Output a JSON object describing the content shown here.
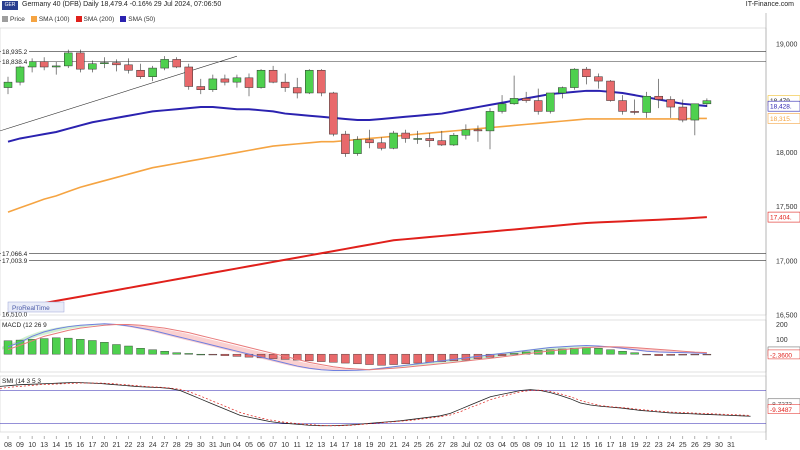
{
  "header": {
    "title": "Germany 40 (DFB) Daily 18,479.4 -0.16% 29 Jul 2024, 07:06:50",
    "brand": "IT-Finance.com",
    "logo_text": "GER"
  },
  "legend": [
    {
      "label": "Price",
      "color": "#9e9e9e"
    },
    {
      "label": "SMA (100)",
      "color": "#f5a442"
    },
    {
      "label": "SMA (200)",
      "color": "#e0201b"
    },
    {
      "label": "SMA (50)",
      "color": "#2b22b0"
    }
  ],
  "watermark": "ProRealTime",
  "colors": {
    "up": "#4ed04e",
    "down": "#e8696b",
    "sma50": "#2b22b0",
    "sma100": "#f5a442",
    "sma200": "#e0201b"
  },
  "chart_data": [
    {
      "type": "candlestick",
      "title": "Germany 40 (DFB) Daily",
      "ylim": [
        16500,
        19150
      ],
      "y_ticks": [
        16500,
        17000,
        17500,
        18000,
        18500,
        19000
      ],
      "x_labels": [
        "08",
        "09",
        "10",
        "13",
        "14",
        "15",
        "16",
        "17",
        "20",
        "21",
        "22",
        "23",
        "24",
        "27",
        "28",
        "29",
        "30",
        "31",
        "Jun",
        "04",
        "05",
        "06",
        "07",
        "10",
        "11",
        "12",
        "13",
        "14",
        "17",
        "18",
        "19",
        "20",
        "21",
        "24",
        "25",
        "26",
        "27",
        "28",
        "Jul",
        "02",
        "03",
        "04",
        "05",
        "08",
        "09",
        "10",
        "11",
        "12",
        "15",
        "16",
        "17",
        "18",
        "19",
        "22",
        "23",
        "24",
        "25",
        "26",
        "29",
        "30",
        "31"
      ],
      "price_tags": [
        {
          "value": 18935.2,
          "label": "18,935.2",
          "side": "left"
        },
        {
          "value": 18838.4,
          "label": "18,838.4",
          "side": "left"
        },
        {
          "value": 17066.4,
          "label": "17,066.4",
          "side": "left"
        },
        {
          "value": 17003.9,
          "label": "17,003.9",
          "side": "left"
        },
        {
          "value": 16510.0,
          "label": "16,510.0",
          "side": "left"
        },
        {
          "value": 18479.4,
          "label": "18,479.",
          "side": "right",
          "color": "#f0c030"
        },
        {
          "value": 18428,
          "label": "18,428.",
          "side": "right",
          "color": "#2b22b0"
        },
        {
          "value": 18315,
          "label": "18,315.",
          "side": "right",
          "color": "#f5a442"
        },
        {
          "value": 17404,
          "label": "17,404.",
          "side": "right",
          "color": "#e0201b"
        }
      ],
      "hlines": [
        18935.2,
        18838.4,
        17066.4,
        17003.9
      ],
      "candles": [
        [
          18600,
          18700,
          18540,
          18650
        ],
        [
          18650,
          18820,
          18620,
          18790
        ],
        [
          18790,
          18870,
          18740,
          18840
        ],
        [
          18840,
          18880,
          18760,
          18790
        ],
        [
          18790,
          18840,
          18720,
          18800
        ],
        [
          18800,
          18950,
          18780,
          18920
        ],
        [
          18920,
          18950,
          18740,
          18770
        ],
        [
          18770,
          18850,
          18740,
          18820
        ],
        [
          18820,
          18880,
          18780,
          18830
        ],
        [
          18830,
          18860,
          18750,
          18810
        ],
        [
          18810,
          18870,
          18730,
          18760
        ],
        [
          18760,
          18820,
          18680,
          18700
        ],
        [
          18700,
          18800,
          18660,
          18780
        ],
        [
          18780,
          18890,
          18760,
          18860
        ],
        [
          18860,
          18880,
          18780,
          18790
        ],
        [
          18790,
          18820,
          18580,
          18610
        ],
        [
          18610,
          18680,
          18540,
          18580
        ],
        [
          18580,
          18720,
          18560,
          18680
        ],
        [
          18680,
          18720,
          18620,
          18650
        ],
        [
          18650,
          18720,
          18600,
          18690
        ],
        [
          18690,
          18730,
          18520,
          18600
        ],
        [
          18600,
          18770,
          18590,
          18760
        ],
        [
          18760,
          18800,
          18640,
          18650
        ],
        [
          18650,
          18730,
          18560,
          18600
        ],
        [
          18600,
          18690,
          18500,
          18550
        ],
        [
          18550,
          18770,
          18540,
          18760
        ],
        [
          18760,
          18770,
          18520,
          18550
        ],
        [
          18550,
          18560,
          18150,
          18170
        ],
        [
          18170,
          18200,
          17960,
          17990
        ],
        [
          17990,
          18150,
          17970,
          18120
        ],
        [
          18120,
          18210,
          18040,
          18090
        ],
        [
          18090,
          18140,
          18020,
          18040
        ],
        [
          18040,
          18200,
          18030,
          18180
        ],
        [
          18180,
          18210,
          18090,
          18130
        ],
        [
          18130,
          18200,
          18080,
          18130
        ],
        [
          18130,
          18180,
          18050,
          18110
        ],
        [
          18110,
          18200,
          18060,
          18070
        ],
        [
          18070,
          18180,
          18060,
          18160
        ],
        [
          18160,
          18260,
          18120,
          18210
        ],
        [
          18210,
          18250,
          18100,
          18200
        ],
        [
          18200,
          18410,
          18030,
          18380
        ],
        [
          18380,
          18530,
          18360,
          18450
        ],
        [
          18450,
          18710,
          18440,
          18500
        ],
        [
          18500,
          18560,
          18460,
          18480
        ],
        [
          18480,
          18590,
          18350,
          18380
        ],
        [
          18380,
          18520,
          18360,
          18550
        ],
        [
          18550,
          18610,
          18500,
          18600
        ],
        [
          18600,
          18780,
          18580,
          18770
        ],
        [
          18770,
          18790,
          18630,
          18700
        ],
        [
          18700,
          18730,
          18590,
          18660
        ],
        [
          18660,
          18670,
          18470,
          18480
        ],
        [
          18480,
          18530,
          18350,
          18380
        ],
        [
          18380,
          18490,
          18350,
          18370
        ],
        [
          18370,
          18560,
          18320,
          18520
        ],
        [
          18520,
          18680,
          18410,
          18490
        ],
        [
          18490,
          18520,
          18320,
          18420
        ],
        [
          18420,
          18490,
          18280,
          18300
        ],
        [
          18300,
          18450,
          18160,
          18450
        ],
        [
          18450,
          18500,
          18420,
          18479
        ]
      ],
      "sma50": [
        18100,
        18130,
        18150,
        18170,
        18190,
        18220,
        18250,
        18280,
        18300,
        18320,
        18340,
        18360,
        18380,
        18390,
        18400,
        18410,
        18420,
        18420,
        18410,
        18400,
        18400,
        18390,
        18380,
        18360,
        18350,
        18340,
        18330,
        18320,
        18310,
        18300,
        18300,
        18310,
        18320,
        18330,
        18340,
        18350,
        18360,
        18380,
        18400,
        18420,
        18440,
        18460,
        18480,
        18500,
        18520,
        18540,
        18550,
        18560,
        18570,
        18570,
        18560,
        18550,
        18530,
        18510,
        18490,
        18470,
        18450,
        18440,
        18430
      ],
      "sma100": [
        17450,
        17490,
        17530,
        17570,
        17600,
        17640,
        17680,
        17710,
        17740,
        17770,
        17800,
        17830,
        17860,
        17880,
        17900,
        17920,
        17940,
        17960,
        17980,
        18000,
        18020,
        18040,
        18060,
        18070,
        18080,
        18090,
        18100,
        18100,
        18110,
        18120,
        18130,
        18140,
        18150,
        18160,
        18170,
        18180,
        18190,
        18200,
        18210,
        18220,
        18230,
        18240,
        18250,
        18260,
        18270,
        18280,
        18290,
        18300,
        18310,
        18310,
        18310,
        18310,
        18310,
        18310,
        18310,
        18310,
        18310,
        18315,
        18315
      ],
      "sma200": [
        16550,
        16570,
        16590,
        16610,
        16630,
        16650,
        16670,
        16690,
        16710,
        16730,
        16750,
        16770,
        16790,
        16810,
        16830,
        16850,
        16870,
        16890,
        16910,
        16930,
        16950,
        16970,
        16990,
        17010,
        17030,
        17050,
        17070,
        17090,
        17110,
        17130,
        17150,
        17170,
        17190,
        17200,
        17210,
        17220,
        17230,
        17240,
        17250,
        17260,
        17270,
        17280,
        17290,
        17300,
        17310,
        17320,
        17330,
        17340,
        17350,
        17355,
        17360,
        17365,
        17370,
        17375,
        17380,
        17385,
        17390,
        17397,
        17404
      ]
    },
    {
      "type": "bar",
      "title": "MACD (12 26 9",
      "ylim": [
        -120,
        230
      ],
      "y_ticks": [
        200,
        100
      ],
      "value_tags": [
        {
          "value": 15,
          "label": "19.467",
          "color": "#555"
        },
        {
          "value": -5,
          "label": "-2.3600",
          "color": "#e0201b"
        }
      ],
      "histogram": [
        90,
        95,
        100,
        105,
        110,
        108,
        100,
        92,
        80,
        65,
        55,
        40,
        30,
        20,
        10,
        5,
        0,
        -5,
        -10,
        -15,
        -20,
        -25,
        -30,
        -35,
        -40,
        -45,
        -50,
        -55,
        -60,
        -65,
        -70,
        -75,
        -70,
        -65,
        -60,
        -55,
        -50,
        -45,
        -40,
        -30,
        -20,
        -10,
        5,
        15,
        25,
        30,
        35,
        40,
        45,
        40,
        30,
        20,
        10,
        -5,
        -10,
        -8,
        -6,
        -5,
        -2
      ],
      "macd": [
        50,
        80,
        120,
        150,
        170,
        185,
        195,
        200,
        205,
        200,
        190,
        175,
        160,
        140,
        120,
        100,
        80,
        60,
        40,
        20,
        0,
        -20,
        -40,
        -60,
        -80,
        -95,
        -105,
        -110,
        -110,
        -108,
        -104,
        -95,
        -85,
        -75,
        -65,
        -55,
        -45,
        -35,
        -25,
        -15,
        -5,
        5,
        15,
        25,
        35,
        45,
        50,
        55,
        58,
        55,
        48,
        40,
        30,
        20,
        15,
        12,
        10,
        8,
        5
      ],
      "signal": [
        30,
        60,
        90,
        120,
        140,
        160,
        175,
        185,
        195,
        200,
        200,
        195,
        185,
        175,
        160,
        145,
        125,
        105,
        85,
        65,
        45,
        25,
        5,
        -15,
        -35,
        -55,
        -70,
        -85,
        -95,
        -100,
        -105,
        -100,
        -95,
        -88,
        -80,
        -72,
        -64,
        -55,
        -46,
        -37,
        -28,
        -18,
        -8,
        2,
        12,
        22,
        30,
        38,
        44,
        48,
        50,
        48,
        44,
        38,
        32,
        26,
        20,
        14,
        10
      ]
    },
    {
      "type": "line",
      "title": "SMI (14 3 5 3",
      "ylim": [
        -60,
        75
      ],
      "value_tags": [
        {
          "value": 8,
          "label": "-8.7273",
          "color": "#555"
        },
        {
          "value": -6,
          "label": "-9.3487",
          "color": "#e0201b"
        }
      ],
      "hlines": [
        40,
        -40
      ],
      "smi": [
        50,
        52,
        54,
        55,
        56,
        57,
        58,
        59,
        59,
        58,
        57,
        55,
        53,
        51,
        49,
        48,
        47,
        45,
        40,
        30,
        20,
        10,
        0,
        -10,
        -20,
        -25,
        -30,
        -35,
        -38,
        -40,
        -42,
        -44,
        -45,
        -45,
        -44,
        -43,
        -41,
        -39,
        -37,
        -35,
        -33,
        -30,
        -27,
        -24,
        -21,
        -15,
        -5,
        5,
        15,
        25,
        30,
        35,
        40,
        42,
        40,
        35,
        28,
        20,
        10,
        5,
        2,
        0,
        -2,
        -5,
        -8,
        -10,
        -12,
        -14,
        -15,
        -16,
        -17,
        -18,
        -19,
        -20,
        -21,
        -22
      ],
      "signal": [
        45,
        48,
        50,
        52,
        54,
        55,
        56,
        57,
        58,
        58,
        58,
        57,
        55,
        53,
        51,
        49,
        48,
        46,
        43,
        36,
        27,
        17,
        7,
        -3,
        -13,
        -20,
        -26,
        -31,
        -35,
        -38,
        -40,
        -42,
        -44,
        -45,
        -45,
        -44,
        -42,
        -40,
        -38,
        -36,
        -34,
        -32,
        -29,
        -26,
        -23,
        -19,
        -11,
        -1,
        8,
        18,
        25,
        31,
        37,
        40,
        41,
        38,
        32,
        25,
        16,
        9,
        4,
        1,
        -1,
        -3,
        -6,
        -8,
        -10,
        -12,
        -13,
        -14,
        -15,
        -16,
        -17,
        -18,
        -19,
        -20
      ]
    }
  ]
}
